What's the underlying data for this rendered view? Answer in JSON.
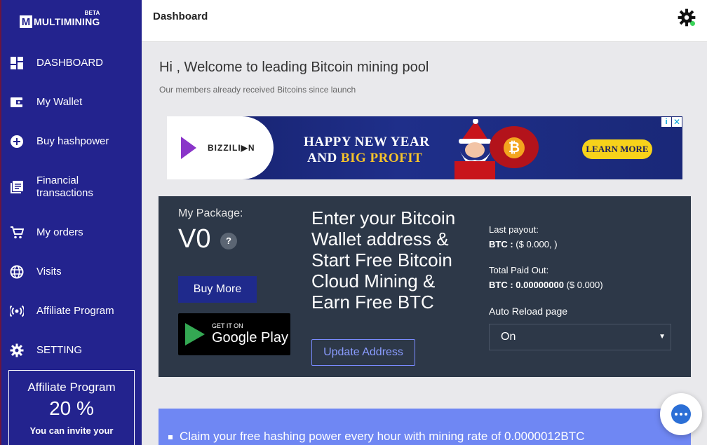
{
  "sidebar": {
    "logo_text": "MULTIMINING",
    "logo_badge": "BETA",
    "items": [
      {
        "label": "DASHBOARD",
        "icon": "dashboard-icon"
      },
      {
        "label": "My Wallet",
        "icon": "wallet-icon"
      },
      {
        "label": "Buy hashpower",
        "icon": "plus-circle-icon"
      },
      {
        "label": "Financial transactions",
        "icon": "list-icon"
      },
      {
        "label": "My orders",
        "icon": "cart-icon"
      },
      {
        "label": "Visits",
        "icon": "globe-icon"
      },
      {
        "label": "Affiliate Program",
        "icon": "broadcast-icon"
      },
      {
        "label": "SETTING",
        "icon": "gear-icon"
      }
    ],
    "affiliate": {
      "title": "Affiliate Program",
      "percent": "20 %",
      "desc": "You can invite your"
    }
  },
  "header": {
    "title": "Dashboard",
    "settings_icon": "gear-icon",
    "status_color": "#3bd35a"
  },
  "main": {
    "welcome": "Hi , Welcome to leading Bitcoin mining pool",
    "subtitle": "Our members already received Bitcoins since launch"
  },
  "ad": {
    "brand": "BIZZILI▶N",
    "headline_1": "HAPPY NEW YEAR",
    "headline_2_prefix": "AND ",
    "headline_2_highlight": "BIG PROFIT",
    "cta": "LEARN MORE",
    "info": "i",
    "close": "✕"
  },
  "package": {
    "label": "My Package:",
    "value": "V0",
    "help": "?",
    "buy_more": "Buy More",
    "gplay_small": "GET IT ON",
    "gplay_big": "Google Play",
    "headline": "Enter your Bitcoin Wallet address & Start Free Bitcoin Cloud Mining & Earn Free BTC",
    "update_button": "Update Address",
    "last_payout_label": "Last payout:",
    "last_payout_prefix": "BTC : ",
    "last_payout_value": "($ 0.000, )",
    "total_paid_label": "Total Paid Out:",
    "total_paid_prefix": "BTC : 0.00000000",
    "total_paid_usd": " ($ 0.000)",
    "auto_reload_label": "Auto Reload page",
    "auto_reload_value": "On"
  },
  "claim": {
    "text": "Claim your free hashing power every hour with mining rate of 0.0000012BTC"
  },
  "colors": {
    "sidebar_bg": "#23238e",
    "panel_bg": "#2d3848",
    "claim_bg": "#6f87f3",
    "accent_blue": "#2b6fd6"
  }
}
